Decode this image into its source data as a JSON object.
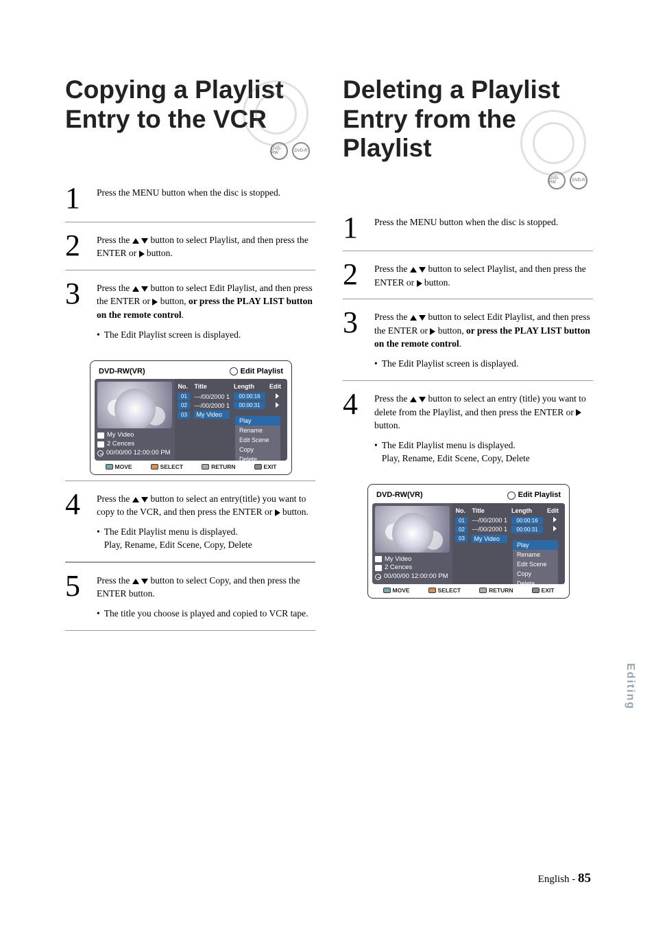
{
  "left": {
    "heading": "Copying a Playlist Entry to the VCR",
    "badges": [
      "DVD-RW",
      "DVD-R"
    ],
    "steps": [
      {
        "num": "1",
        "text_pre": "Press the MENU button when the disc is stopped.",
        "text_b": "",
        "text_post": ""
      },
      {
        "num": "2",
        "text_pre": "Press the ",
        "arrows": "ud",
        "text_mid": " button to select Playlist, and then press the ENTER or ",
        "arrow2": "r",
        "text_post": " button."
      },
      {
        "num": "3",
        "text_pre": "Press the ",
        "arrows": "ud",
        "text_mid": " button to select Edit Playlist, and then press the ENTER or ",
        "arrow2": "r",
        "text_post": " button, ",
        "bold": "or press the PLAY LIST button on the remote control",
        "tail": ".",
        "bullet": "The Edit Playlist screen is displayed.",
        "osd": true
      },
      {
        "num": "4",
        "text_pre": "Press the ",
        "arrows": "ud",
        "text_mid": " button to select an entry(title) you want to copy to the VCR, and then press the ENTER or ",
        "arrow2": "r",
        "text_post": " button.",
        "bullet": "The Edit Playlist menu is displayed.",
        "bullet2": "Play, Rename, Edit Scene, Copy, Delete"
      },
      {
        "num": "5",
        "text_pre": "Press the ",
        "arrows": "ud",
        "text_mid": " button to select Copy, and then press the ENTER button.",
        "bullet": "The title you choose is played and copied to VCR tape."
      }
    ]
  },
  "right": {
    "heading": "Deleting a Playlist Entry from the Playlist",
    "badges": [
      "DVD-RW",
      "DVD-R"
    ],
    "steps": [
      {
        "num": "1",
        "text_pre": "Press the MENU button when the disc is stopped.",
        "text_b": "",
        "text_post": ""
      },
      {
        "num": "2",
        "text_pre": "Press the ",
        "arrows": "ud",
        "text_mid": " button to select Playlist, and then press the ENTER or ",
        "arrow2": "r",
        "text_post": " button."
      },
      {
        "num": "3",
        "text_pre": "Press the ",
        "arrows": "ud",
        "text_mid": " button to select Edit Playlist, and then press the ENTER or ",
        "arrow2": "r",
        "text_post": " button, ",
        "bold": "or press the PLAY LIST button on the remote control",
        "tail": ".",
        "bullet": "The Edit Playlist screen is displayed."
      },
      {
        "num": "4",
        "text_pre": "Press the ",
        "arrows": "ud",
        "text_mid": " button to select an entry (title) you want to delete from the Playlist, and then press the ENTER or ",
        "arrow2": "r",
        "text_post": " button.",
        "bullet": "The Edit Playlist menu is displayed.",
        "bullet2": "Play, Rename, Edit Scene, Copy, Delete",
        "osd": true
      }
    ]
  },
  "osd": {
    "disc_label": "DVD-RW(VR)",
    "title_label": "Edit Playlist",
    "meta": {
      "title": "My Video",
      "scenes": "2 Cences",
      "time": "00/00/00 12:00:00  PM"
    },
    "cols": {
      "no": "No.",
      "title": "Title",
      "length": "Length",
      "edit": "Edit"
    },
    "rows": [
      {
        "no": "01",
        "title": "---/00/2000 1",
        "length": "00:00:16"
      },
      {
        "no": "02",
        "title": "---/00/2000 1",
        "length": "00:00:31"
      },
      {
        "no": "03",
        "title": "My Video",
        "length": "",
        "selected": true
      }
    ],
    "popup": [
      "Play",
      "Rename",
      "Edit Scene",
      "Copy",
      "Delete"
    ],
    "popup_highlight": "Play",
    "footer": {
      "move": "MOVE",
      "select": "SELECT",
      "return": "RETURN",
      "exit": "EXIT"
    }
  },
  "sidetab": "Editing",
  "footer": {
    "lang": "English",
    "sep": " - ",
    "page": "85"
  }
}
